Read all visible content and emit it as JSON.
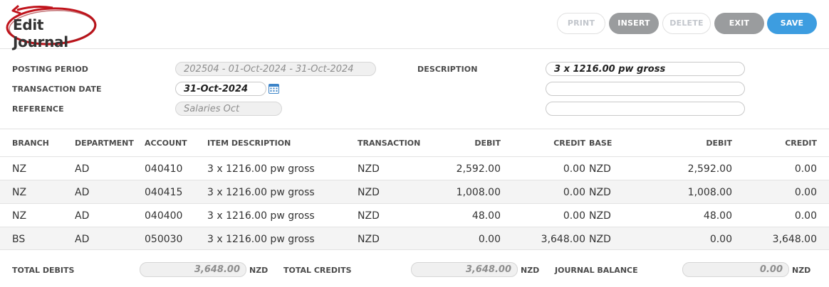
{
  "header": {
    "title": "Edit Journal",
    "buttons": {
      "print": "PRINT",
      "insert": "INSERT",
      "delete": "DELETE",
      "exit": "EXIT",
      "save": "SAVE"
    }
  },
  "form": {
    "posting_period_label": "POSTING PERIOD",
    "posting_period_value": "202504 - 01-Oct-2024 - 31-Oct-2024",
    "transaction_date_label": "TRANSACTION DATE",
    "transaction_date_value": "31-Oct-2024",
    "reference_label": "REFERENCE",
    "reference_value": "Salaries Oct",
    "description_label": "DESCRIPTION",
    "description_value": "3 x 1216.00 pw gross",
    "description_line2": "",
    "description_line3": ""
  },
  "table": {
    "headers": {
      "branch": "BRANCH",
      "department": "DEPARTMENT",
      "account": "ACCOUNT",
      "item_description": "ITEM DESCRIPTION",
      "transaction": "TRANSACTION",
      "debit": "DEBIT",
      "credit": "CREDIT",
      "base": "BASE",
      "base_debit": "DEBIT",
      "base_credit": "CREDIT"
    },
    "rows": [
      {
        "branch": "NZ",
        "department": "AD",
        "account": "040410",
        "item_description": "3 x 1216.00 pw gross",
        "transaction": "NZD",
        "debit": "2,592.00",
        "credit": "0.00",
        "base": "NZD",
        "base_debit": "2,592.00",
        "base_credit": "0.00"
      },
      {
        "branch": "NZ",
        "department": "AD",
        "account": "040415",
        "item_description": "3 x 1216.00 pw gross",
        "transaction": "NZD",
        "debit": "1,008.00",
        "credit": "0.00",
        "base": "NZD",
        "base_debit": "1,008.00",
        "base_credit": "0.00"
      },
      {
        "branch": "NZ",
        "department": "AD",
        "account": "040400",
        "item_description": "3 x 1216.00 pw gross",
        "transaction": "NZD",
        "debit": "48.00",
        "credit": "0.00",
        "base": "NZD",
        "base_debit": "48.00",
        "base_credit": "0.00"
      },
      {
        "branch": "BS",
        "department": "AD",
        "account": "050030",
        "item_description": "3 x 1216.00 pw gross",
        "transaction": "NZD",
        "debit": "0.00",
        "credit": "3,648.00",
        "base": "NZD",
        "base_debit": "0.00",
        "base_credit": "3,648.00"
      }
    ]
  },
  "totals": {
    "total_debits_label": "TOTAL DEBITS",
    "total_debits_value": "3,648.00",
    "total_debits_unit": "NZD",
    "total_credits_label": "TOTAL CREDITS",
    "total_credits_value": "3,648.00",
    "total_credits_unit": "NZD",
    "journal_balance_label": "JOURNAL BALANCE",
    "journal_balance_value": "0.00",
    "journal_balance_unit": "NZD"
  },
  "colors": {
    "accent": "#3d9de0",
    "grey_button": "#9a9c9e",
    "annotation": "#c0141c"
  }
}
